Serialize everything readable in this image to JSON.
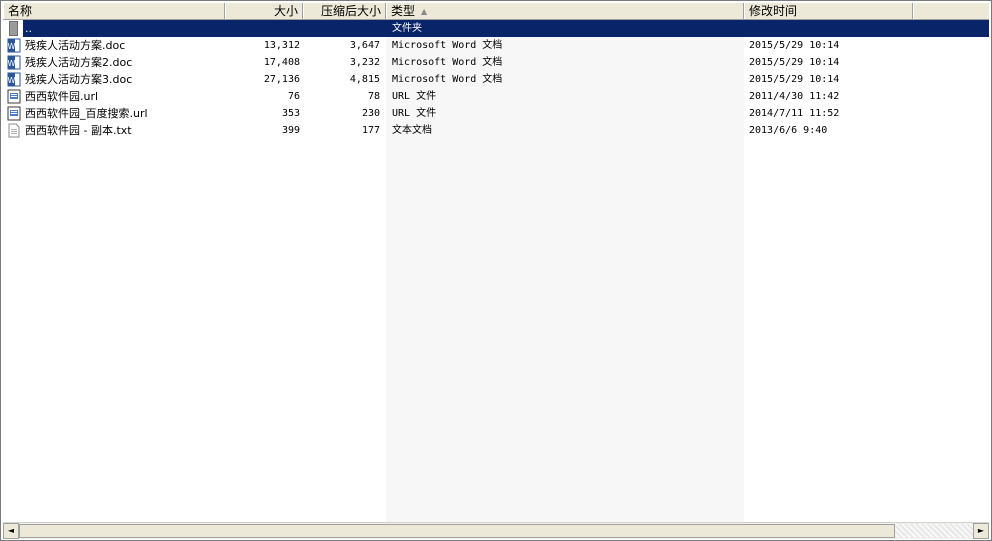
{
  "columns": {
    "name": "名称",
    "size": "大小",
    "packed": "压缩后大小",
    "type": "类型",
    "modified": "修改时间"
  },
  "sort_indicator": "▲",
  "parent_row": {
    "name": "..",
    "type": "文件夹"
  },
  "files": [
    {
      "name": "残疾人活动方案.doc",
      "size": "13,312",
      "packed": "3,647",
      "type": "Microsoft Word 文档",
      "modified": "2015/5/29 10:14",
      "icon": "word-doc-icon"
    },
    {
      "name": "残疾人活动方案2.doc",
      "size": "17,408",
      "packed": "3,232",
      "type": "Microsoft Word 文档",
      "modified": "2015/5/29 10:14",
      "icon": "word-doc-icon"
    },
    {
      "name": "残疾人活动方案3.doc",
      "size": "27,136",
      "packed": "4,815",
      "type": "Microsoft Word 文档",
      "modified": "2015/5/29 10:14",
      "icon": "word-doc-icon"
    },
    {
      "name": "西西软件园.url",
      "size": "76",
      "packed": "78",
      "type": "URL 文件",
      "modified": "2011/4/30 11:42",
      "icon": "url-file-icon"
    },
    {
      "name": "西西软件园_百度搜索.url",
      "size": "353",
      "packed": "230",
      "type": "URL 文件",
      "modified": "2014/7/11 11:52",
      "icon": "url-file-icon"
    },
    {
      "name": "西西软件园 - 副本.txt",
      "size": "399",
      "packed": "177",
      "type": "文本文档",
      "modified": "2013/6/6 9:40",
      "icon": "text-file-icon"
    }
  ],
  "scrollbar": {
    "left_arrow": "◄",
    "right_arrow": "►"
  }
}
